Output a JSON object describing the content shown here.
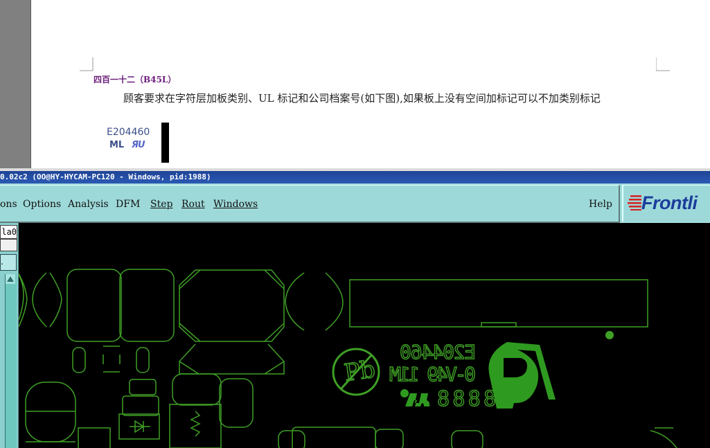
{
  "document": {
    "heading": "四百一十二（B45L）",
    "body": "顾客要求在字符层加板类别、UL 标记和公司档案号(如下图),如果板上没有空间加标记可以不加类别标记",
    "ul_image": {
      "code": "E204460",
      "ml": "ML",
      "mark": "ЯU"
    }
  },
  "window": {
    "title": "0.02c2 (OO@HY-HYCAM-PC120 - Windows, pid:1988)"
  },
  "menu": {
    "items": [
      "ons",
      "Options",
      "Analysis",
      "DFM",
      "Step",
      "Rout",
      "Windows"
    ],
    "help": "Help",
    "logo": "Frontli"
  },
  "left_panel": {
    "field_value": "la0",
    "button_label": "."
  },
  "canvas": {
    "board_text_code": "E204460",
    "board_text_rating": "0-V49 11M",
    "board_text_date": "8888",
    "colors": {
      "outline": "#3fa026",
      "fill": "#2f9a20",
      "background": "#000000"
    }
  }
}
